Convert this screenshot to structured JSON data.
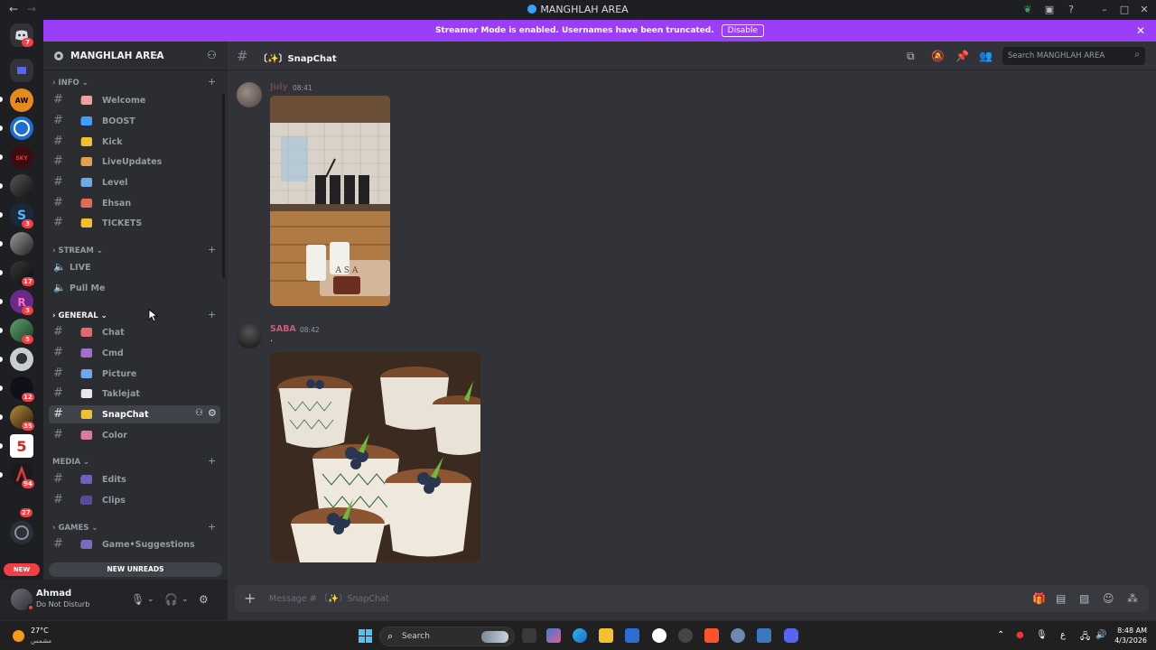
{
  "window": {
    "title": "MANGHLAH AREA"
  },
  "rail": {
    "badges": [
      "7",
      "3",
      "17",
      "3",
      "5",
      "12",
      "35",
      "94",
      "27"
    ],
    "new_label": "NEW"
  },
  "banner": {
    "text": "Streamer Mode is enabled. Usernames have been truncated.",
    "button": "Disable",
    "color": "#9a3ff7"
  },
  "server": {
    "name": "MANGHLAH AREA"
  },
  "sidebar": {
    "categories": [
      {
        "name": "INFO",
        "channels": [
          "Welcome",
          "BOOST",
          "Kick",
          "LiveUpdates",
          "Level",
          "Ehsan",
          "TICKETS"
        ]
      },
      {
        "name": "STREAM",
        "voice": [
          "LIVE",
          "Pull Me"
        ]
      },
      {
        "name": "GENERAL",
        "channels": [
          "Chat",
          "Cmd",
          "Picture",
          "Taklejat",
          "SnapChat",
          "Color"
        ]
      },
      {
        "name": "MEDIA",
        "channels": [
          "Edits",
          "Clips"
        ]
      },
      {
        "name": "GAMES",
        "channels": [
          "Game•Suggestions"
        ]
      }
    ],
    "active_channel": "SnapChat",
    "new_unreads": "NEW UNREADS"
  },
  "user": {
    "name": "Ahmad",
    "status": "Do Not Disturb"
  },
  "chat": {
    "channel": "SnapChat",
    "search_placeholder": "Search MANGHLAH AREA",
    "messages": [
      {
        "author": "July",
        "time": "08:41",
        "text": "",
        "author_color": "#6b4a4a"
      },
      {
        "author": "SABA",
        "time": "08:42",
        "text": ".",
        "author_color": "#c45f7a"
      }
    ],
    "composer_placeholder": "Message # 〔✨〕SnapChat"
  },
  "taskbar": {
    "temperature": "27°C",
    "condition": "مشمس",
    "search": "Search",
    "time": "8:48 AM",
    "date": "4/3/2026",
    "lang": "ع"
  },
  "accent": {
    "blurple": "#5865f2",
    "dnd": "#f23f43"
  }
}
